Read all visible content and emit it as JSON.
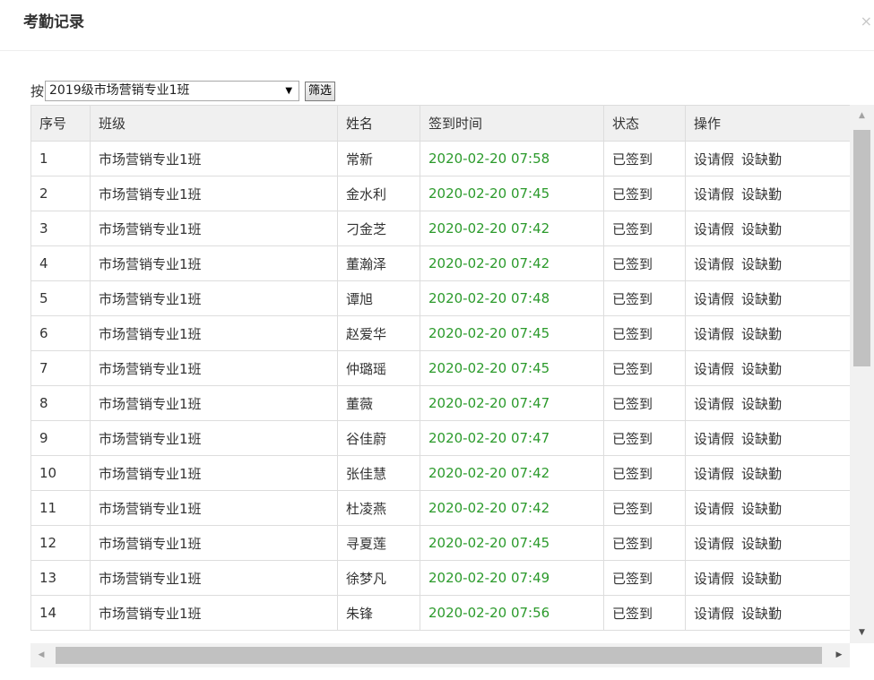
{
  "dialog": {
    "title": "考勤记录",
    "close_glyph": "×"
  },
  "filter": {
    "prefix": "按",
    "selected_class": "2019级市场营销专业1班",
    "button_label": "筛选"
  },
  "table": {
    "headers": {
      "index": "序号",
      "class": "班级",
      "name": "姓名",
      "time": "签到时间",
      "status": "状态",
      "actions": "操作"
    },
    "rows": [
      {
        "index": "1",
        "class": "市场营销专业1班",
        "name": "常新",
        "time": "2020-02-20 07:58",
        "status": "已签到",
        "leave": "设请假",
        "absent": "设缺勤"
      },
      {
        "index": "2",
        "class": "市场营销专业1班",
        "name": "金水利",
        "time": "2020-02-20 07:45",
        "status": "已签到",
        "leave": "设请假",
        "absent": "设缺勤"
      },
      {
        "index": "3",
        "class": "市场营销专业1班",
        "name": "刁金芝",
        "time": "2020-02-20 07:42",
        "status": "已签到",
        "leave": "设请假",
        "absent": "设缺勤"
      },
      {
        "index": "4",
        "class": "市场营销专业1班",
        "name": "董瀚泽",
        "time": "2020-02-20 07:42",
        "status": "已签到",
        "leave": "设请假",
        "absent": "设缺勤"
      },
      {
        "index": "5",
        "class": "市场营销专业1班",
        "name": "谭旭",
        "time": "2020-02-20 07:48",
        "status": "已签到",
        "leave": "设请假",
        "absent": "设缺勤"
      },
      {
        "index": "6",
        "class": "市场营销专业1班",
        "name": "赵爱华",
        "time": "2020-02-20 07:45",
        "status": "已签到",
        "leave": "设请假",
        "absent": "设缺勤"
      },
      {
        "index": "7",
        "class": "市场营销专业1班",
        "name": "仲璐瑶",
        "time": "2020-02-20 07:45",
        "status": "已签到",
        "leave": "设请假",
        "absent": "设缺勤"
      },
      {
        "index": "8",
        "class": "市场营销专业1班",
        "name": "董薇",
        "time": "2020-02-20 07:47",
        "status": "已签到",
        "leave": "设请假",
        "absent": "设缺勤"
      },
      {
        "index": "9",
        "class": "市场营销专业1班",
        "name": "谷佳蔚",
        "time": "2020-02-20 07:47",
        "status": "已签到",
        "leave": "设请假",
        "absent": "设缺勤"
      },
      {
        "index": "10",
        "class": "市场营销专业1班",
        "name": "张佳慧",
        "time": "2020-02-20 07:42",
        "status": "已签到",
        "leave": "设请假",
        "absent": "设缺勤"
      },
      {
        "index": "11",
        "class": "市场营销专业1班",
        "name": "杜凌燕",
        "time": "2020-02-20 07:42",
        "status": "已签到",
        "leave": "设请假",
        "absent": "设缺勤"
      },
      {
        "index": "12",
        "class": "市场营销专业1班",
        "name": "寻夏莲",
        "time": "2020-02-20 07:45",
        "status": "已签到",
        "leave": "设请假",
        "absent": "设缺勤"
      },
      {
        "index": "13",
        "class": "市场营销专业1班",
        "name": "徐梦凡",
        "time": "2020-02-20 07:49",
        "status": "已签到",
        "leave": "设请假",
        "absent": "设缺勤"
      },
      {
        "index": "14",
        "class": "市场营销专业1班",
        "name": "朱锋",
        "time": "2020-02-20 07:56",
        "status": "已签到",
        "leave": "设请假",
        "absent": "设缺勤"
      }
    ]
  },
  "colors": {
    "time_text": "#2b9a2b",
    "header_bg": "#f0f0f0",
    "border": "#dddddd"
  }
}
